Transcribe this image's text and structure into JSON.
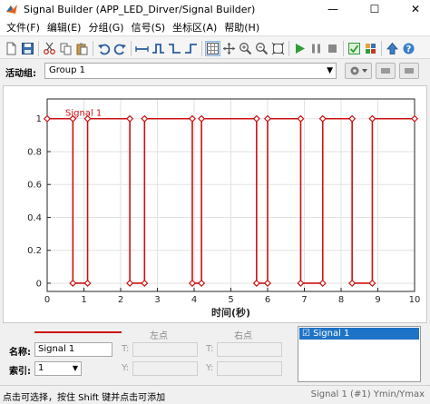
{
  "window": {
    "title": "Signal Builder (APP_LED_Dirver/Signal Builder)",
    "minimize": "—",
    "maximize": "☐",
    "close": "✕"
  },
  "menu": [
    "文件(F)",
    "编辑(E)",
    "分组(G)",
    "信号(S)",
    "坐标区(A)",
    "帮助(H)"
  ],
  "toolbar_icons": [
    "new-icon",
    "save-icon",
    "cut-icon",
    "copy-icon",
    "paste-icon",
    "undo-icon",
    "redo-icon",
    "step-icon",
    "pulse-icon",
    "signal-up-icon",
    "signal-down-icon",
    "grid-icon",
    "pan-icon",
    "zoom-in-icon",
    "zoom-out-icon",
    "fit-icon",
    "run-icon",
    "pause-icon",
    "stop-icon",
    "verification-icon",
    "library-icon",
    "up-arrow-icon",
    "help-icon"
  ],
  "group": {
    "label": "活动组:",
    "selected": "Group 1"
  },
  "bottom": {
    "left_point_header": "左点",
    "right_point_header": "右点",
    "name_label": "名称:",
    "name_value": "Signal 1",
    "index_label": "索引:",
    "index_value": "1",
    "t_label": "T:",
    "y_label": "Y:",
    "signal_list": [
      "☑ Signal 1"
    ]
  },
  "status": {
    "text": "点击可选择，按住 Shift 键并点击可添加",
    "right": "Signal 1 (#1)   Ymin/Ymax"
  },
  "colors": {
    "signal": "#cc1111",
    "selection": "#1f73c7"
  },
  "chart_data": {
    "type": "line",
    "xlabel": "时间(秒)",
    "ylabel": "",
    "xlim": [
      0,
      10
    ],
    "ylim": [
      -0.05,
      1.12
    ],
    "grid": true,
    "x_ticks": [
      0,
      1,
      2,
      3,
      4,
      5,
      6,
      7,
      8,
      9,
      10
    ],
    "y_ticks": [
      0,
      0.2,
      0.4,
      0.6,
      0.8,
      1
    ],
    "y_tick_labels": [
      "0",
      "0.2",
      "0.4",
      "0.6",
      "0.8",
      "1"
    ],
    "series": [
      {
        "name": "Signal 1",
        "x": [
          0,
          0.7,
          0.7,
          1.1,
          1.1,
          2.25,
          2.25,
          2.65,
          2.65,
          3.95,
          3.95,
          4.2,
          4.2,
          5.7,
          5.7,
          6,
          6,
          6.9,
          6.9,
          7.5,
          7.5,
          8.3,
          8.3,
          8.85,
          8.85,
          10
        ],
        "y": [
          1,
          1,
          0,
          0,
          1,
          1,
          0,
          0,
          1,
          1,
          0,
          0,
          1,
          1,
          0,
          0,
          1,
          1,
          0,
          0,
          1,
          1,
          0,
          0,
          1,
          1
        ]
      }
    ]
  }
}
